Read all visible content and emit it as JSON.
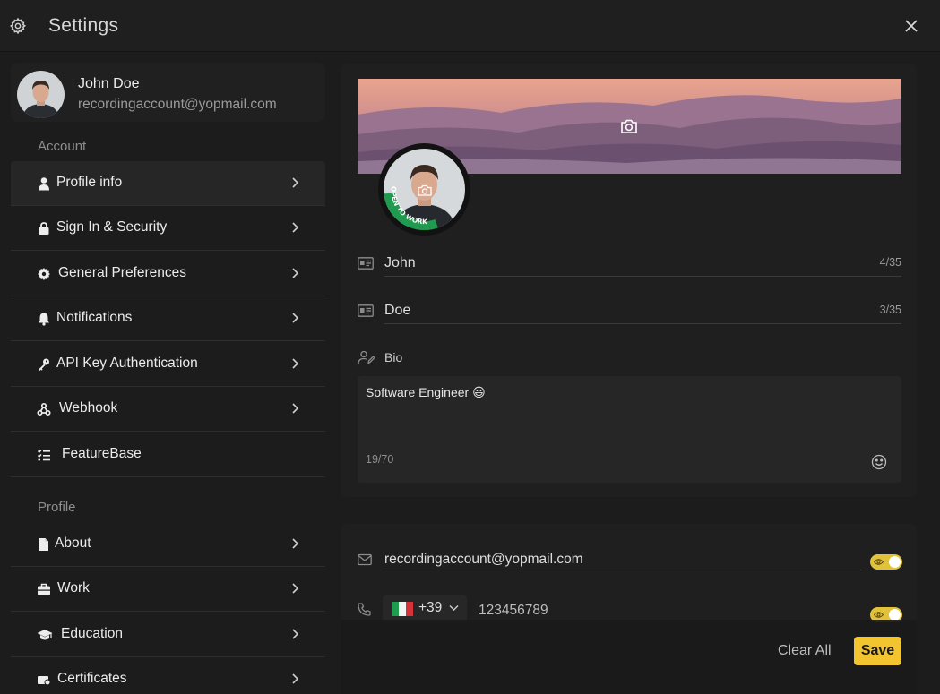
{
  "header": {
    "title": "Settings",
    "gear_icon": "gear-icon",
    "close_icon": "close-icon"
  },
  "user": {
    "name": "John Doe",
    "email": "recordingaccount@yopmail.com"
  },
  "sidebar": {
    "account_section": "Account",
    "account_items": [
      {
        "label": "Profile info",
        "icon": "user-icon",
        "active": true
      },
      {
        "label": "Sign In & Security",
        "icon": "lock-icon"
      },
      {
        "label": "General Preferences",
        "icon": "cog-icon"
      },
      {
        "label": "Notifications",
        "icon": "bell-icon"
      },
      {
        "label": "API Key Authentication",
        "icon": "key-icon"
      },
      {
        "label": "Webhook",
        "icon": "webhook-icon"
      },
      {
        "label": "FeatureBase",
        "icon": "checklist-icon"
      }
    ],
    "profile_section": "Profile",
    "profile_items": [
      {
        "label": "About",
        "icon": "file-icon"
      },
      {
        "label": "Work",
        "icon": "briefcase-icon"
      },
      {
        "label": "Education",
        "icon": "graduation-cap-icon"
      },
      {
        "label": "Certificates",
        "icon": "certificate-icon"
      }
    ]
  },
  "profile": {
    "badge_text": "OPEN TO WORK",
    "first_name": {
      "value": "John",
      "count": "4/35"
    },
    "last_name": {
      "value": "Doe",
      "count": "3/35"
    },
    "bio": {
      "label": "Bio",
      "value": "Software Engineer 😃",
      "count": "19/70"
    }
  },
  "contact": {
    "email": "recordingaccount@yopmail.com",
    "phone": {
      "country_code": "+39",
      "number": "123456789"
    }
  },
  "colors": {
    "accent": "#f2c530",
    "toggle": "#e2c23b",
    "badge": "#1f9a4e"
  },
  "footer": {
    "clear_label": "Clear All",
    "save_label": "Save"
  }
}
